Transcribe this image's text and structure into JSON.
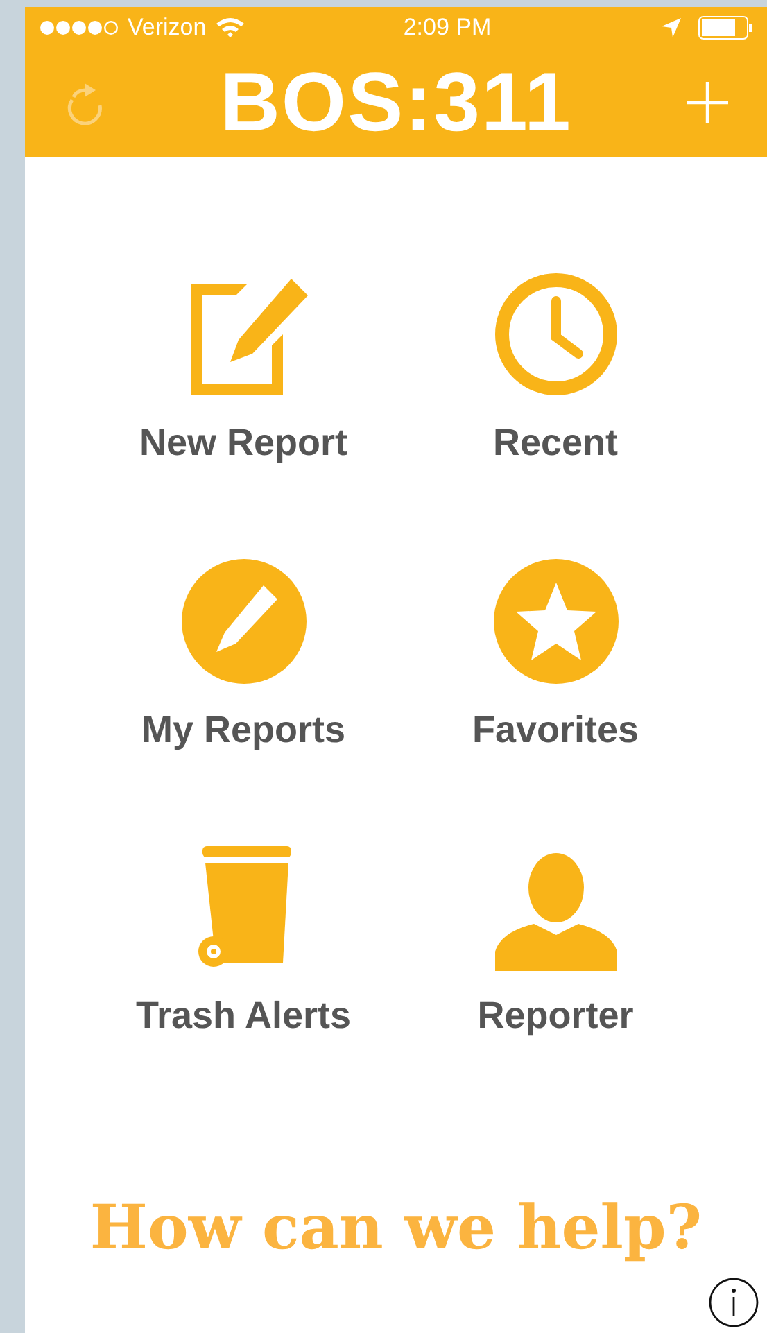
{
  "status_bar": {
    "carrier": "Verizon",
    "time": "2:09 PM"
  },
  "header": {
    "title": "BOS:311"
  },
  "tiles": [
    {
      "label": "New Report"
    },
    {
      "label": "Recent"
    },
    {
      "label": "My Reports"
    },
    {
      "label": "Favorites"
    },
    {
      "label": "Trash Alerts"
    },
    {
      "label": "Reporter"
    }
  ],
  "tagline": "How can we help?"
}
